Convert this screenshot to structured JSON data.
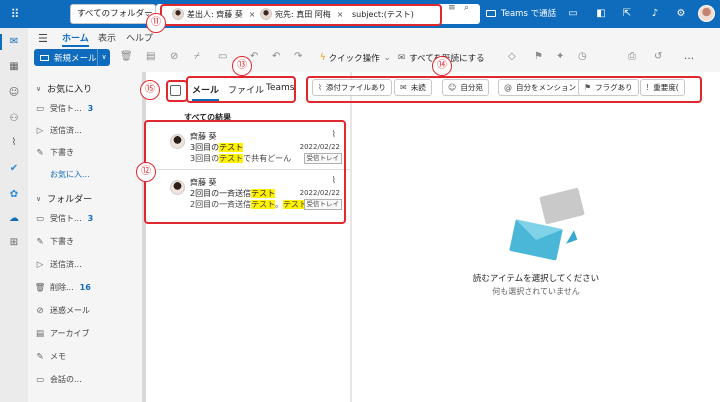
{
  "topbar": {
    "scope_label": "すべてのフォルダー",
    "chips": [
      {
        "label": "差出人: 齊藤 葵"
      },
      {
        "label": "宛先: 真田 阿梅"
      }
    ],
    "query_text": "subject:(テスト)",
    "teams_label": "Teams で通話"
  },
  "ribbon": {
    "tabs": [
      "ホーム",
      "表示",
      "ヘルプ"
    ],
    "new_mail_label": "新規メール",
    "quick_action_label": "クイック操作",
    "mark_read_label": "すべてを既読にする"
  },
  "folders": {
    "favorites_header": "お気に入り",
    "favorites": [
      {
        "label": "受信ト...",
        "count": "3"
      },
      {
        "label": "送信済..."
      },
      {
        "label": "下書き"
      }
    ],
    "favorites_link": "お気に入...",
    "folders_header": "フォルダー",
    "items": [
      {
        "label": "受信ト...",
        "count": "3"
      },
      {
        "label": "下書き"
      },
      {
        "label": "送信済..."
      },
      {
        "label": "削除...",
        "count": "16"
      },
      {
        "label": "迷惑メール"
      },
      {
        "label": "アーカイブ"
      },
      {
        "label": "メモ"
      },
      {
        "label": "会話の..."
      }
    ]
  },
  "list": {
    "tabs": [
      "メール",
      "ファイル",
      "Teams"
    ],
    "results_header": "すべての結果",
    "messages": [
      {
        "from": "齊藤 葵",
        "subject_pre": "3回目の",
        "subject_hl": "テスト",
        "preview_pre": "3回目の",
        "preview_hl": "テスト",
        "preview_post": "で共有どーん",
        "date": "2022/02/22",
        "folder": "受信トレイ"
      },
      {
        "from": "齊藤 葵",
        "subject_pre": "2回目の一斉送信",
        "subject_hl": "テスト",
        "preview_pre": "2回目の一斉送信",
        "preview_hl": "テスト",
        "preview_post": "。",
        "preview_hl2": "テスト",
        "date": "2022/02/22",
        "folder": "受信トレイ"
      }
    ]
  },
  "filters": [
    {
      "label": "添付ファイルあり",
      "icon": "paperclip-icon"
    },
    {
      "label": "未読",
      "icon": "envelope-icon"
    },
    {
      "label": "自分宛",
      "icon": "person-icon"
    },
    {
      "label": "自分をメンション",
      "icon": "at-icon"
    },
    {
      "label": "フラグあり",
      "icon": "flag-icon"
    },
    {
      "label": "重要度(",
      "icon": "exclamation-icon"
    }
  ],
  "reading": {
    "title": "読むアイテムを選択してください",
    "subtitle": "何も選択されていません"
  },
  "annotations": [
    "⑪",
    "⑫",
    "⑬",
    "⑭",
    "⑮"
  ],
  "colors": {
    "accent": "#0f6cbd",
    "highlight": "#fff100",
    "annotation": "#e0282e"
  }
}
